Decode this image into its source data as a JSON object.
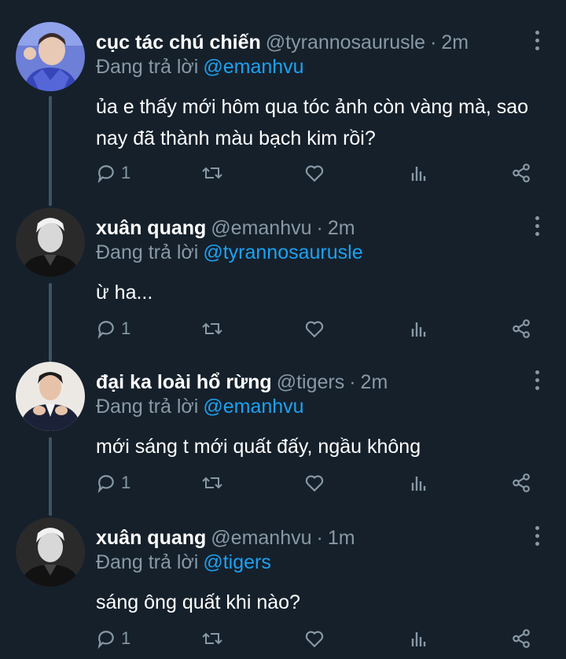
{
  "replying_prefix": "Đang trả lời",
  "tweets": [
    {
      "name": "cục tác chú chiến",
      "handle": "@tyrannosaurusle",
      "time": "2m",
      "reply_to": "@emanhvu",
      "text": "ủa e thấy mới hôm qua tóc ảnh còn vàng mà, sao nay đã thành màu bạch kim rồi?",
      "reply_count": "1",
      "avatar_icon": "avatar-blue-portrait"
    },
    {
      "name": "xuân quang",
      "handle": "@emanhvu",
      "time": "2m",
      "reply_to": "@tyrannosaurusle",
      "text": "ừ ha...",
      "reply_count": "1",
      "avatar_icon": "avatar-mono-portrait"
    },
    {
      "name": "đại ka loài hổ rừng",
      "handle": "@tigers",
      "time": "2m",
      "reply_to": "@emanhvu",
      "text": "mới sáng t mới quất đấy, ngầu không",
      "reply_count": "1",
      "avatar_icon": "avatar-suit-portrait"
    },
    {
      "name": "xuân quang",
      "handle": "@emanhvu",
      "time": "1m",
      "reply_to": "@tigers",
      "text": "sáng ông quất khi nào?",
      "reply_count": "1",
      "avatar_icon": "avatar-mono-portrait"
    }
  ],
  "colors": {
    "background": "#15202b",
    "secondary_text": "#8899a6",
    "mention": "#1da1f2",
    "thread_line": "#3d5466"
  }
}
